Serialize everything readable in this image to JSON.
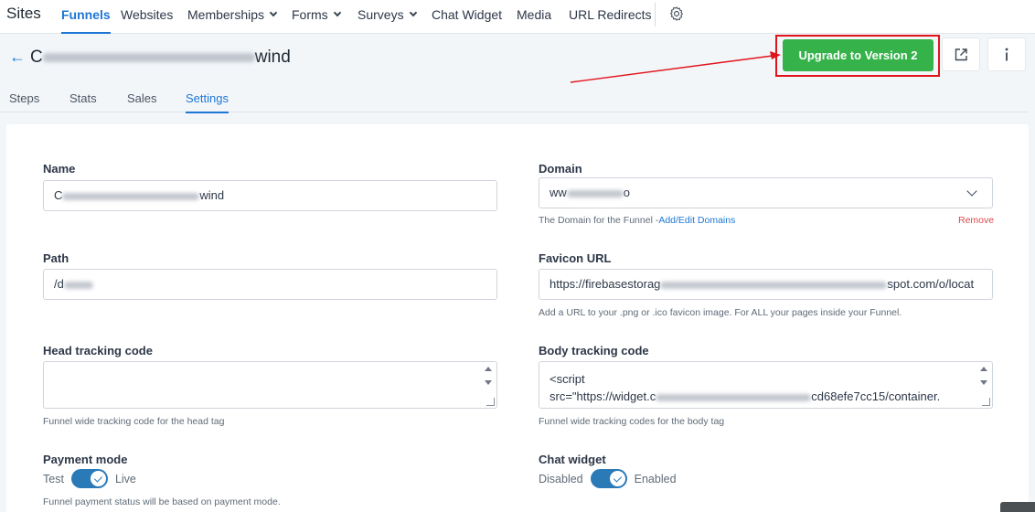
{
  "nav": {
    "brand": "Sites",
    "items": [
      {
        "label": "Funnels"
      },
      {
        "label": "Websites"
      },
      {
        "label": "Memberships"
      },
      {
        "label": "Forms"
      },
      {
        "label": "Surveys"
      },
      {
        "label": "Chat Widget"
      },
      {
        "label": "Media"
      },
      {
        "label": "URL Redirects"
      }
    ],
    "active": "Funnels"
  },
  "header": {
    "title_start": "C",
    "title_end": "wind",
    "upgrade_label": "Upgrade to Version 2"
  },
  "tabs": [
    {
      "label": "Steps"
    },
    {
      "label": "Stats"
    },
    {
      "label": "Sales"
    },
    {
      "label": "Settings"
    }
  ],
  "active_tab": "Settings",
  "form": {
    "name": {
      "label": "Name",
      "value_start": "C",
      "value_end": "wind"
    },
    "domain": {
      "label": "Domain",
      "value_start": "ww",
      "value_end": "o",
      "help_text": "The Domain for the Funnel -",
      "help_link": "Add/Edit Domains",
      "remove_label": "Remove"
    },
    "path": {
      "label": "Path",
      "value_start": "/d"
    },
    "favicon": {
      "label": "Favicon URL",
      "value_start": "https://firebasestorag",
      "value_end": "spot.com/o/locat",
      "help_text": "Add a URL to your .png or .ico favicon image. For ALL your pages inside your Funnel."
    },
    "head_tracking": {
      "label": "Head tracking code",
      "help_text": "Funnel wide tracking code for the head tag"
    },
    "body_tracking": {
      "label": "Body tracking code",
      "line1": "<script",
      "line2_start": "src=\"https://widget.c",
      "line2_end": "cd68efe7cc15/container.",
      "help_text": "Funnel wide tracking codes for the body tag"
    },
    "payment_mode": {
      "label": "Payment mode",
      "off_label": "Test",
      "on_label": "Live",
      "help_text": "Funnel payment status will be based on payment mode."
    },
    "chat_widget": {
      "label": "Chat widget",
      "off_label": "Disabled",
      "on_label": "Enabled"
    }
  },
  "colors": {
    "accent": "#1e77d4",
    "upgrade_bg": "#36b24b",
    "highlight": "#e0141c",
    "toggle_on": "#2b7ab8",
    "remove": "#e04848"
  }
}
